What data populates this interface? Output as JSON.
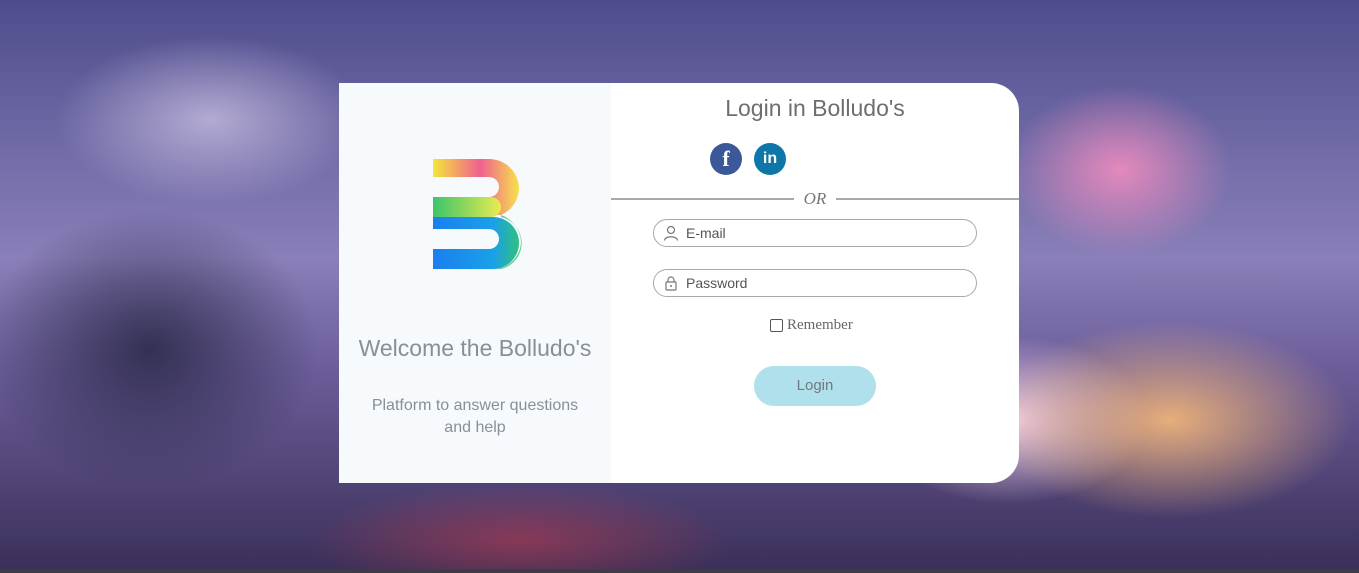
{
  "left_panel": {
    "logo": "bolludo-b-logo",
    "welcome": "Welcome the Bolludo's",
    "tagline": "Platform to answer questions and help"
  },
  "login": {
    "title": "Login in Bolludo's",
    "social": [
      {
        "icon": "facebook-icon",
        "glyph": "f",
        "color": "#3b5998"
      },
      {
        "icon": "linkedin-icon",
        "glyph": "in",
        "color": "#0e76a8"
      }
    ],
    "divider_text": "OR",
    "email_placeholder": "E-mail",
    "password_placeholder": "Password",
    "remember_label": "Remember",
    "submit_label": "Login"
  },
  "colors": {
    "card_left_bg": "#f6fafd",
    "card_right_bg": "#ffffff",
    "button_bg": "#b0e0ec",
    "text_muted": "#8a8f96"
  }
}
